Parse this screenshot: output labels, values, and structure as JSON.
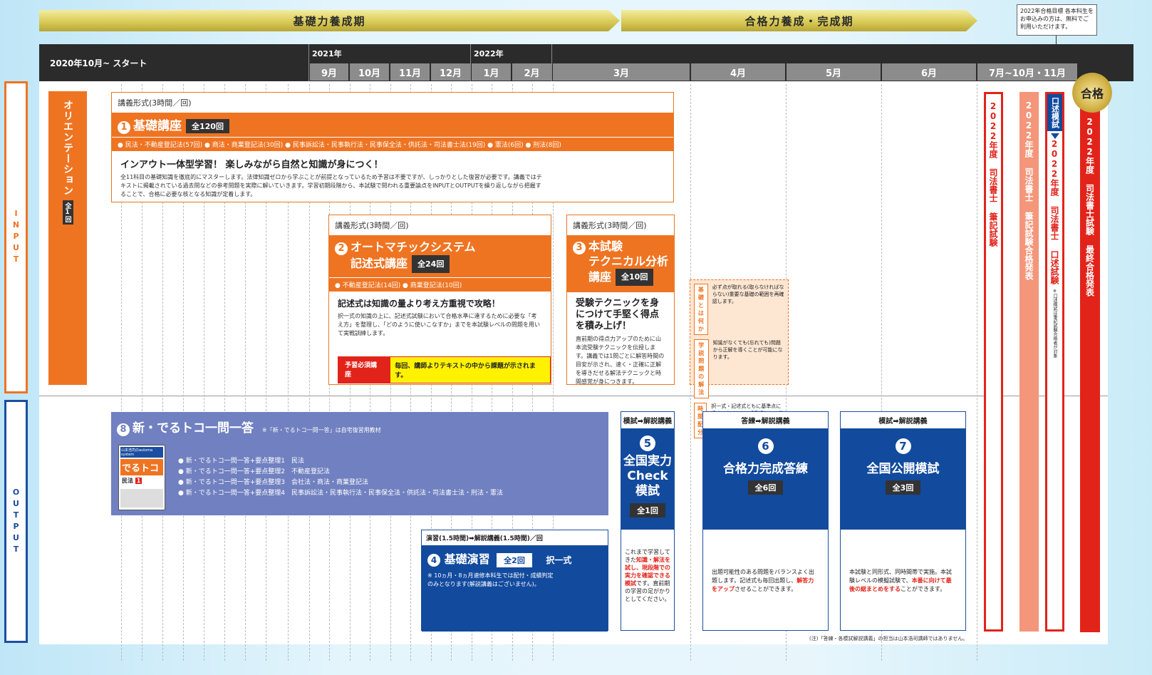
{
  "phases": {
    "foundation": "基礎力養成期",
    "completion": "合格力養成・完成期"
  },
  "note_top": "2022年合格目標 各本科生をお申込みの方は、無料でご利用いただけます。",
  "timeline": {
    "start": "2020年10月~ スタート",
    "year2021": "2021年",
    "year2022": "2022年",
    "months": [
      "9月",
      "10月",
      "11月",
      "12月",
      "1月",
      "2月",
      "3月",
      "4月",
      "5月",
      "6月",
      "7月~10月・11月"
    ]
  },
  "side": {
    "input": "INPUT",
    "output": "OUTPUT"
  },
  "orientation": {
    "label": "オリエンテーション",
    "count": "全1回"
  },
  "c1": {
    "format": "講義形式(3時間／回)",
    "num": "1",
    "title": "基礎講座",
    "count": "全120回",
    "subjects": "● 民法・不動産登記法(57回) ● 商法・商業登記法(30回) ● 民事訴訟法・民事執行法・民事保全法・供託法・司法書士法(19回) ● 憲法(6回) ● 刑法(8回)",
    "headline": "インアウト一体型学習！ 楽しみながら自然と知識が身につく！",
    "body": "全11科目の基礎知識を徹底的にマスターします。法律知識ゼロから学ぶことが前提となっているため予習は不要ですが、しっかりとした復習が必要です。講義ではテキストに掲載されている過去問などの参考問題を実際に解いていきます。学習初期段階から、本試験で問われる重要論点をINPUTとOUTPUTを繰り返しながら把握することで、合格に必要な核となる知識が定着します。"
  },
  "c2": {
    "format": "講義形式(3時間／回)",
    "num": "2",
    "title1": "オートマチックシステム",
    "title2": "記述式講座",
    "count": "全24回",
    "subjects": "● 不動産登記法(14回) ● 商業登記法(10回)",
    "headline": "記述式は知識の量より考え方重視で攻略！",
    "body": "択一式の知識の上に、記述式試験において合格水準に達するために必要な「考え方」を整理し、「どのように使いこなすか」までを本試験レベルの問題を用いて実戦訓練します。",
    "badge": "予習必須講座",
    "badge_note": "毎回、講師よりテキストの中から課題が示されます。"
  },
  "c3": {
    "format": "講義形式(3時間／回)",
    "num": "3",
    "title1": "本試験",
    "title2": "テクニカル分析",
    "title3": "講座",
    "count": "全10回",
    "headline": "受験テクニックを身につけて手堅く得点を積み上げ！",
    "body": "直前期の得点力アップのために山本流受験テクニックを伝授します。講義では1問ごとに解答時間の目安が示され、速く・正確に正解を導きだせる解法テクニックと時間感覚が身につきます。"
  },
  "tech": [
    {
      "k": "基礎とは何か",
      "v": "必ず点が取れる(取らなければならない)重要な基礎の範囲を再確認します。"
    },
    {
      "k": "学説問題の解法",
      "v": "知識がなくても(忘れても)問題から正解を導くことが可能になります。"
    },
    {
      "k": "時間配分",
      "v": "択一式・記述式ともに基準点に達するためには、「見切り」の能力が必要になります。"
    }
  ],
  "c8": {
    "num": "8",
    "title": "新・でるトコ一問一答",
    "note": "※「新・でるトコ一問一答」は自宅復習用教材",
    "items": [
      "● 新・でるトコ一問一答+要点整理1　民法",
      "● 新・でるトコ一問一答+要点整理2　不動産登記法",
      "● 新・でるトコ一問一答+要点整理3　会社法・商法・商業登記法",
      "● 新・でるトコ一問一答+要点整理4　民事訴訟法・民事執行法・民事保全法・供託法・司法書士法・刑法・憲法"
    ],
    "book": {
      "brand": "山本浩司のautoma system",
      "title": "でるトコ",
      "sub": "民法",
      "tag": "1"
    }
  },
  "c4": {
    "format": "演習(1.5時間)➡解説講義(1.5時間)／回",
    "num": "4",
    "title": "基礎演習",
    "count": "全2回",
    "kind": "択一式",
    "note": "※ 10ヵ月・8ヵ月速修本科生では配付・成績判定のみとなります(解説講義はございません)。"
  },
  "c5": {
    "head": "模試➡解説講義",
    "num": "5",
    "t1": "全国実力",
    "t2": "Check",
    "t3": "模試",
    "count": "全1回",
    "desc1": "これまで学習してきた",
    "desc2": "知識・解法を試し、現段階での実力を確認できる模試",
    "desc3": "です。直前期の学習の足がかりとしてください。"
  },
  "c6": {
    "head": "答練➡解説講義",
    "num": "6",
    "title": "合格力完成答練",
    "count": "全6回",
    "desc1": "出題可能性のある問題をバランスよく出題します。記述式も毎回出題し、",
    "desc2": "解答力をアップ",
    "desc3": "させることができます。"
  },
  "c7": {
    "head": "模試➡解説講義",
    "num": "7",
    "title": "全国公開模試",
    "count": "全3回",
    "desc1": "本試験と同形式、同時間帯で実施。本試験レベルの模擬試験で、",
    "desc2": "本番に向けて最後の総まとめをする",
    "desc3": "ことができます。"
  },
  "exams": {
    "written": "2022年度 司法書士 筆記試験",
    "written_result": "2022年度 司法書士 筆記試験合格発表",
    "oral_mock": "口述模試",
    "oral": "2022年度 司法書士 口述試験",
    "oral_note": "※口述模試は筆記試験合格者が対象",
    "final": "2022年度 司法書士試験 最終合格発表",
    "pass": "合格"
  },
  "footnote": "(注)「答練・各模試解説講義」の担当は山本浩司講師ではありません。"
}
